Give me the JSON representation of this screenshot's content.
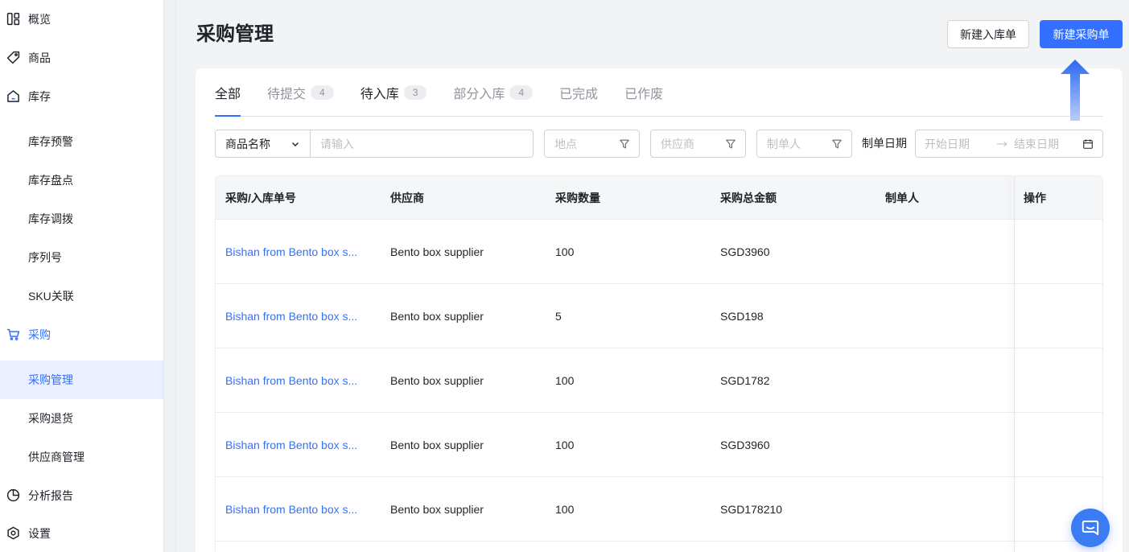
{
  "theme": {
    "accent": "#3370ff",
    "selected_bg": "#eaf0ff",
    "text": "#1f2329"
  },
  "sidebar": {
    "items": [
      {
        "label": "概览",
        "icon": "dashboard-icon"
      },
      {
        "label": "商品",
        "icon": "tag-icon"
      },
      {
        "label": "库存",
        "icon": "warehouse-icon"
      },
      {
        "label": "库存预警"
      },
      {
        "label": "库存盘点"
      },
      {
        "label": "库存调拨"
      },
      {
        "label": "序列号"
      },
      {
        "label": "SKU关联"
      },
      {
        "label": "采购",
        "icon": "cart-icon",
        "active": true
      },
      {
        "label": "采购管理",
        "selected": true
      },
      {
        "label": "采购退货"
      },
      {
        "label": "供应商管理"
      },
      {
        "label": "分析报告",
        "icon": "pie-chart-icon"
      },
      {
        "label": "设置",
        "icon": "settings-icon"
      }
    ]
  },
  "header": {
    "title": "采购管理",
    "new_inbound_label": "新建入库单",
    "new_purchase_label": "新建采购单"
  },
  "tabs": [
    {
      "label": "全部",
      "selected": true
    },
    {
      "label": "待提交",
      "count": "4"
    },
    {
      "label": "待入库",
      "count": "3"
    },
    {
      "label": "部分入库",
      "count": "4"
    },
    {
      "label": "已完成"
    },
    {
      "label": "已作废"
    }
  ],
  "filters": {
    "search_field": "商品名称",
    "keyword_placeholder": "请输入",
    "location_placeholder": "地点",
    "supplier_placeholder": "供应商",
    "creator_placeholder": "制单人",
    "date_label": "制单日期",
    "start_date_placeholder": "开始日期",
    "end_date_placeholder": "结束日期"
  },
  "table": {
    "columns": [
      "采购/入库单号",
      "供应商",
      "采购数量",
      "采购总金额",
      "制单人",
      "操作"
    ],
    "rows": [
      {
        "order_no": "Bishan from Bento box s...",
        "supplier": "Bento box supplier",
        "quantity": "100",
        "total_amount": "SGD3960"
      },
      {
        "order_no": "Bishan from Bento box s...",
        "supplier": "Bento box supplier",
        "quantity": "5",
        "total_amount": "SGD198"
      },
      {
        "order_no": "Bishan from Bento box s...",
        "supplier": "Bento box supplier",
        "quantity": "100",
        "total_amount": "SGD1782"
      },
      {
        "order_no": "Bishan from Bento box s...",
        "supplier": "Bento box supplier",
        "quantity": "100",
        "total_amount": "SGD3960"
      },
      {
        "order_no": "Bishan from Bento box s...",
        "supplier": "Bento box supplier",
        "quantity": "100",
        "total_amount": "SGD178210"
      }
    ]
  },
  "guide": {
    "icon": "arrow-up-icon"
  },
  "chat_widget": {
    "icon": "chat-icon"
  }
}
